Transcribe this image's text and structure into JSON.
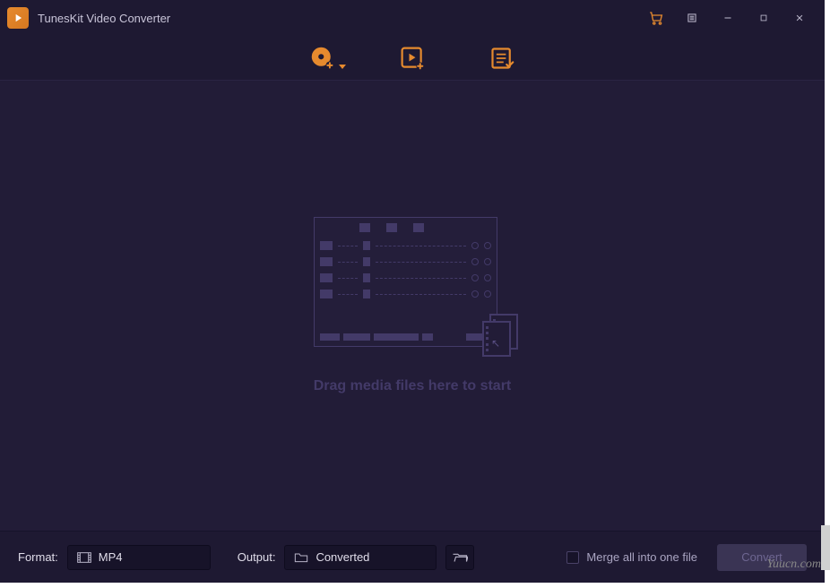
{
  "app": {
    "title": "TunesKit Video Converter"
  },
  "toolbar": {
    "disc_label": "Load DVD",
    "video_label": "Add Video",
    "list_label": "Task List"
  },
  "main": {
    "drop_text": "Drag media files here to start"
  },
  "footer": {
    "format_label": "Format:",
    "format_value": "MP4",
    "output_label": "Output:",
    "output_value": "Converted",
    "merge_label": "Merge all into one file",
    "convert_label": "Convert"
  },
  "watermark": "Yuucn.com",
  "colors": {
    "accent": "#e68a2e",
    "bg_dark": "#1e1932",
    "bg_main": "#221c37",
    "text_muted": "#433a68"
  }
}
